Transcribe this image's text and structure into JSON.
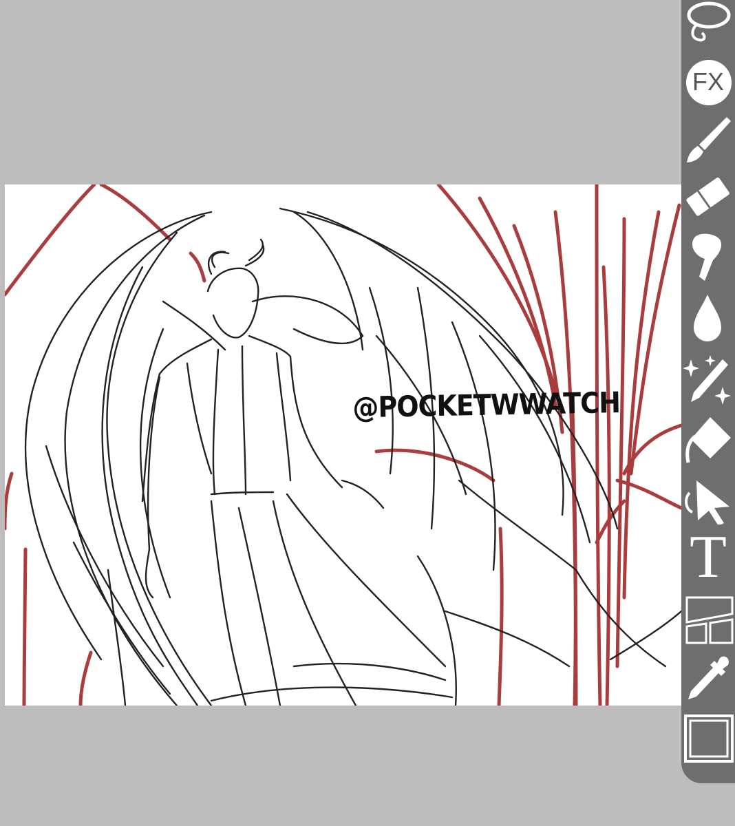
{
  "canvas": {
    "watermark_text": "@POCKETWWATCH"
  },
  "toolbar": {
    "tools": [
      {
        "name": "lasso",
        "icon": "lasso-icon"
      },
      {
        "name": "filter",
        "icon": "fx-icon",
        "label": "FX"
      },
      {
        "name": "brush",
        "icon": "brush-icon"
      },
      {
        "name": "eraser",
        "icon": "eraser-icon"
      },
      {
        "name": "smudge",
        "icon": "smudge-icon"
      },
      {
        "name": "blur",
        "icon": "blur-drop-icon"
      },
      {
        "name": "special-brush",
        "icon": "sparkle-pen-icon"
      },
      {
        "name": "fill",
        "icon": "fill-bucket-icon"
      },
      {
        "name": "move",
        "icon": "move-arrow-icon"
      },
      {
        "name": "text",
        "icon": "text-icon",
        "label": "T"
      },
      {
        "name": "frame-divider",
        "icon": "frame-divider-icon"
      },
      {
        "name": "eyedropper",
        "icon": "eyedropper-icon"
      },
      {
        "name": "color",
        "icon": "color-swatch-icon"
      }
    ]
  },
  "colors": {
    "background": "#bdbdbd",
    "toolbar": "#6e6e6e",
    "sketch_red": "#9b1b1b",
    "sketch_black": "#222222",
    "current_color": "#6e6e6e"
  }
}
